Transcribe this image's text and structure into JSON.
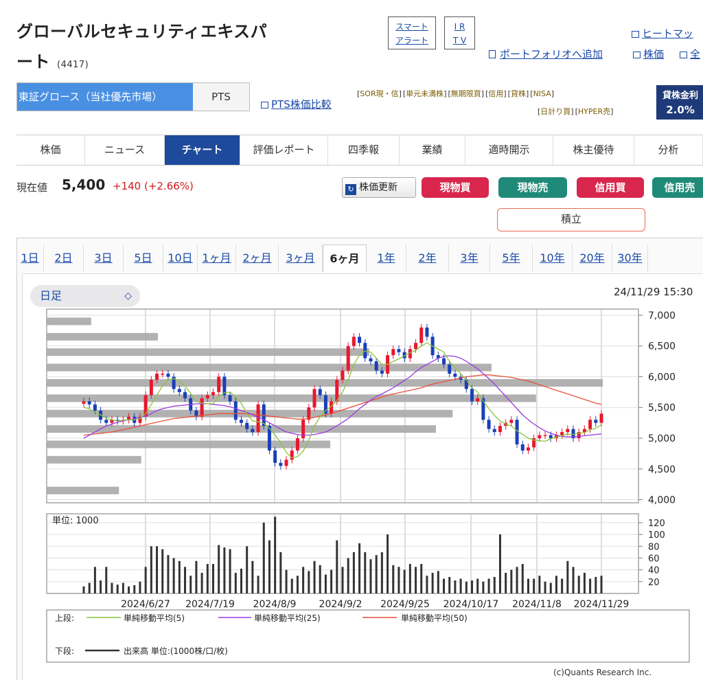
{
  "stock": {
    "name_line1": "グローバルセキュリティエキスパ",
    "name_line2": "ート",
    "code": "(4417)"
  },
  "header": {
    "smart_alert_1": "スマート",
    "smart_alert_2": "アラート",
    "irtv_1": "I R",
    "irtv_2": "T V",
    "heatmap": "ヒートマッ",
    "add_portfolio": "ポートフォリオへ追加",
    "stock_price": "株価",
    "all": "全"
  },
  "market": {
    "primary": "東証グロース（当社優先市場）",
    "pts": "PTS",
    "pts_compare": "PTS株価比較"
  },
  "tags": {
    "row1": [
      "SOR現・信",
      "単元未満株",
      "無期限買",
      "信用",
      "貸株",
      "NISA"
    ],
    "row2": [
      "日計り買",
      "HYPER売"
    ]
  },
  "lending": {
    "label": "貸株金利",
    "rate": "2.0%"
  },
  "nav": {
    "tabs": [
      "株価",
      "ニュース",
      "チャート",
      "評価レポート",
      "四季報",
      "業績",
      "適時開示",
      "株主優待",
      "分析"
    ],
    "active": "チャート"
  },
  "price": {
    "label": "現在値",
    "value": "5,400",
    "change": "+140 (+2.66%)"
  },
  "trade_buttons": {
    "refresh": "株価更新",
    "cash_buy": "現物買",
    "cash_sell": "現物売",
    "margin_buy": "信用買",
    "margin_sell": "信用売",
    "accumulate": "積立",
    "colors": {
      "buy": "#d8264d",
      "sell": "#1f8a78"
    }
  },
  "periods": {
    "items": [
      "1日",
      "2日",
      "3日",
      "5日",
      "10日",
      "1ヶ月",
      "2ヶ月",
      "3ヶ月",
      "6ヶ月",
      "1年",
      "2年",
      "3年",
      "5年",
      "10年",
      "20年",
      "30年"
    ],
    "active": "6ヶ月"
  },
  "chart_controls": {
    "interval": "日足",
    "timestamp": "24/11/29 15:30"
  },
  "chart_data": {
    "type": "candlestick",
    "price_axis": {
      "ticks": [
        "7,000",
        "6,500",
        "6,000",
        "5,500",
        "5,000",
        "4,500",
        "4,000"
      ],
      "ylim": [
        3950,
        7100
      ]
    },
    "x_labels": [
      "2024/6/27",
      "2024/7/19",
      "2024/8/9",
      "2024/9/2",
      "2024/9/25",
      "2024/10/17",
      "2024/11/8",
      "2024/11/29"
    ],
    "close": [
      5600,
      5550,
      5450,
      5300,
      5250,
      5300,
      5280,
      5300,
      5350,
      5250,
      5350,
      5700,
      5950,
      6050,
      6050,
      6000,
      5800,
      5750,
      5650,
      5450,
      5350,
      5650,
      5700,
      5750,
      6000,
      5700,
      5600,
      5300,
      5250,
      5150,
      5100,
      5550,
      5200,
      4800,
      4600,
      4550,
      4650,
      4800,
      5000,
      5300,
      5500,
      5800,
      5700,
      5400,
      5600,
      5950,
      6100,
      6500,
      6650,
      6550,
      6300,
      6250,
      6100,
      6050,
      6350,
      6450,
      6400,
      6300,
      6450,
      6550,
      6800,
      6650,
      6350,
      6300,
      6200,
      6050,
      6000,
      5950,
      5800,
      5600,
      5650,
      5300,
      5150,
      5100,
      5200,
      5250,
      5300,
      4900,
      4800,
      4850,
      5000,
      5050,
      5050,
      5000,
      5050,
      5100,
      5150,
      5000,
      5100,
      5150,
      5300,
      5250,
      5400
    ],
    "ma5": [
      5500,
      5480,
      5420,
      5380,
      5330,
      5300,
      5280,
      5290,
      5300,
      5300,
      5320,
      5400,
      5550,
      5700,
      5850,
      5950,
      5970,
      5930,
      5850,
      5730,
      5600,
      5570,
      5560,
      5560,
      5680,
      5740,
      5750,
      5670,
      5570,
      5400,
      5280,
      5270,
      5240,
      5160,
      5050,
      4930,
      4770,
      4680,
      4700,
      4790,
      4970,
      5200,
      5350,
      5450,
      5520,
      5610,
      5750,
      5950,
      6200,
      6350,
      6420,
      6400,
      6300,
      6200,
      6200,
      6250,
      6290,
      6340,
      6390,
      6430,
      6500,
      6550,
      6500,
      6450,
      6400,
      6250,
      6150,
      6050,
      5950,
      5820,
      5750,
      5600,
      5480,
      5370,
      5280,
      5230,
      5200,
      5120,
      5060,
      5000,
      4970,
      4960,
      4950,
      4990,
      5020,
      5040,
      5070,
      5060,
      5080,
      5090,
      5140,
      5160,
      5220
    ],
    "ma25": [
      5000,
      5050,
      5100,
      5150,
      5200,
      5230,
      5260,
      5280,
      5300,
      5320,
      5340,
      5360,
      5400,
      5450,
      5480,
      5500,
      5520,
      5530,
      5540,
      5550,
      5560,
      5560,
      5560,
      5550,
      5540,
      5530,
      5510,
      5480,
      5450,
      5420,
      5380,
      5340,
      5300,
      5250,
      5200,
      5150,
      5100,
      5080,
      5060,
      5050,
      5050,
      5060,
      5080,
      5100,
      5150,
      5200,
      5260,
      5320,
      5400,
      5480,
      5550,
      5620,
      5680,
      5720,
      5770,
      5820,
      5880,
      5940,
      6000,
      6080,
      6150,
      6200,
      6250,
      6300,
      6330,
      6340,
      6330,
      6300,
      6250,
      6190,
      6130,
      6050,
      5970,
      5880,
      5780,
      5680,
      5580,
      5480,
      5380,
      5300,
      5230,
      5170,
      5120,
      5080,
      5050,
      5030,
      5020,
      5020,
      5030,
      5040,
      5050,
      5060,
      5070
    ],
    "ma50": [
      5050,
      5060,
      5070,
      5080,
      5090,
      5100,
      5120,
      5140,
      5160,
      5180,
      5200,
      5220,
      5240,
      5260,
      5280,
      5300,
      5320,
      5330,
      5340,
      5350,
      5360,
      5370,
      5380,
      5390,
      5400,
      5400,
      5400,
      5400,
      5400,
      5400,
      5390,
      5380,
      5370,
      5360,
      5350,
      5340,
      5330,
      5320,
      5310,
      5310,
      5320,
      5340,
      5360,
      5380,
      5400,
      5430,
      5460,
      5490,
      5520,
      5550,
      5580,
      5610,
      5640,
      5670,
      5700,
      5720,
      5740,
      5760,
      5780,
      5800,
      5820,
      5850,
      5880,
      5900,
      5920,
      5940,
      5960,
      5980,
      6000,
      6010,
      6020,
      6030,
      6030,
      6020,
      6010,
      6000,
      5990,
      5970,
      5950,
      5930,
      5900,
      5870,
      5840,
      5810,
      5780,
      5750,
      5720,
      5690,
      5660,
      5630,
      5600,
      5570,
      5550
    ],
    "volume_profile": [
      {
        "price": 6900,
        "width": 0.08
      },
      {
        "price": 6650,
        "width": 0.2
      },
      {
        "price": 6400,
        "width": 0.58
      },
      {
        "price": 6150,
        "width": 0.8
      },
      {
        "price": 5900,
        "width": 1.0
      },
      {
        "price": 5650,
        "width": 0.88
      },
      {
        "price": 5400,
        "width": 0.73
      },
      {
        "price": 5150,
        "width": 0.7
      },
      {
        "price": 4900,
        "width": 0.51
      },
      {
        "price": 4650,
        "width": 0.17
      },
      {
        "price": 4150,
        "width": 0.13
      }
    ],
    "volume_axis": {
      "unit_label": "単位: 1000",
      "ticks": [
        "120",
        "100",
        "80",
        "60",
        "40",
        "20"
      ],
      "ylim": [
        0,
        135
      ]
    },
    "volume": [
      12,
      18,
      45,
      22,
      45,
      18,
      15,
      18,
      12,
      14,
      20,
      45,
      80,
      80,
      75,
      65,
      60,
      55,
      45,
      30,
      55,
      35,
      50,
      50,
      82,
      78,
      75,
      35,
      42,
      80,
      55,
      30,
      120,
      90,
      130,
      70,
      40,
      25,
      30,
      45,
      38,
      55,
      48,
      32,
      40,
      90,
      45,
      60,
      70,
      85,
      70,
      58,
      65,
      70,
      100,
      48,
      45,
      40,
      50,
      45,
      50,
      30,
      35,
      38,
      25,
      28,
      22,
      25,
      20,
      22,
      25,
      20,
      25,
      28,
      100,
      35,
      40,
      45,
      50,
      25,
      25,
      30,
      20,
      18,
      30,
      25,
      55,
      45,
      30,
      35,
      25,
      28,
      30
    ],
    "legend": {
      "upper_label": "上段:",
      "ma5": "単純移動平均(5)",
      "ma25": "単純移動平均(25)",
      "ma50": "単純移動平均(50)",
      "lower_label": "下段:",
      "volume": "出来高 単位:(1000株/口/枚)"
    },
    "colors": {
      "up": "#e8182e",
      "down": "#1a3fb8",
      "ma5": "#8ac43a",
      "ma25": "#9a3be0",
      "ma50": "#e8503a",
      "profile": "#a8a8a8",
      "volume": "#333333"
    }
  },
  "footer": {
    "copyright": "(c)Quants Research Inc."
  }
}
